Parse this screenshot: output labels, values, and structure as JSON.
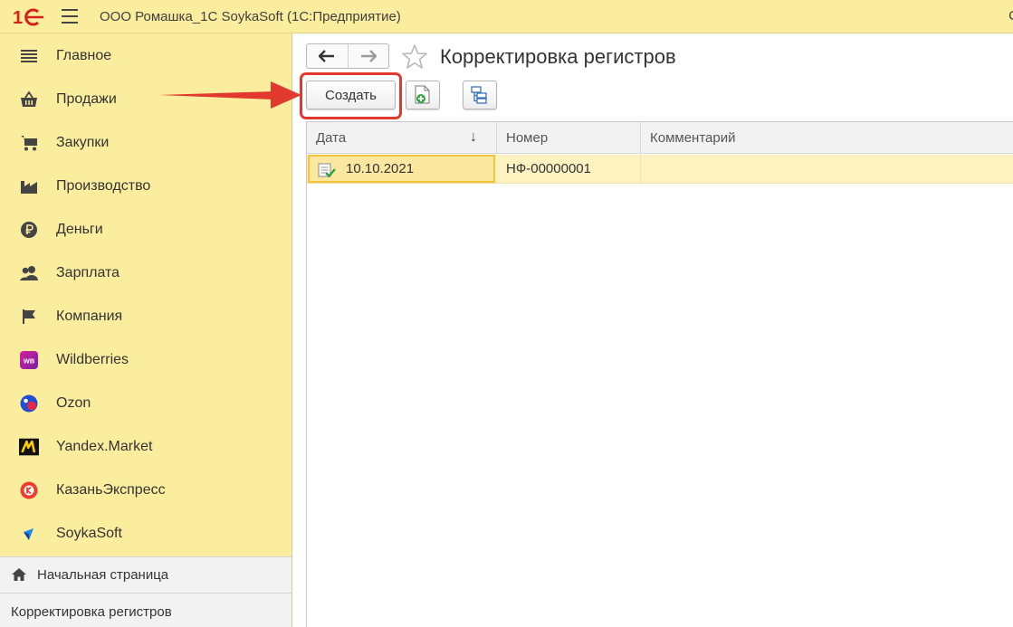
{
  "app": {
    "title": "ООО Ромашка_1С SoykaSoft  (1С:Предприятие)",
    "title_edge": "С"
  },
  "sidebar": {
    "items": [
      {
        "label": "Главное",
        "icon": "menu-lines-icon"
      },
      {
        "label": "Продажи",
        "icon": "basket-icon"
      },
      {
        "label": "Закупки",
        "icon": "cart-icon"
      },
      {
        "label": "Производство",
        "icon": "factory-icon"
      },
      {
        "label": "Деньги",
        "icon": "ruble-icon"
      },
      {
        "label": "Зарплата",
        "icon": "people-icon"
      },
      {
        "label": "Компания",
        "icon": "flag-icon"
      },
      {
        "label": "Wildberries",
        "icon": "wildberries-icon"
      },
      {
        "label": "Ozon",
        "icon": "ozon-icon"
      },
      {
        "label": "Yandex.Market",
        "icon": "yandex-market-icon"
      },
      {
        "label": "КазаньЭкспресс",
        "icon": "kazanexpress-icon"
      },
      {
        "label": "SoykaSoft",
        "icon": "soykasoft-icon"
      }
    ],
    "wb_badge": "WB",
    "home_label": "Начальная страница",
    "open_label": "Корректировка регистров"
  },
  "main": {
    "title": "Корректировка регистров",
    "create_label": "Создать"
  },
  "table": {
    "columns": [
      "Дата",
      "Номер",
      "Комментарий"
    ],
    "sort_indicator": "↓",
    "rows": [
      {
        "date": "10.10.2021",
        "number": "НФ-00000001",
        "comment": ""
      }
    ]
  },
  "colors": {
    "panel": "#fbed9e",
    "selection": "#fdf2c0",
    "highlight": "#e2392e"
  }
}
